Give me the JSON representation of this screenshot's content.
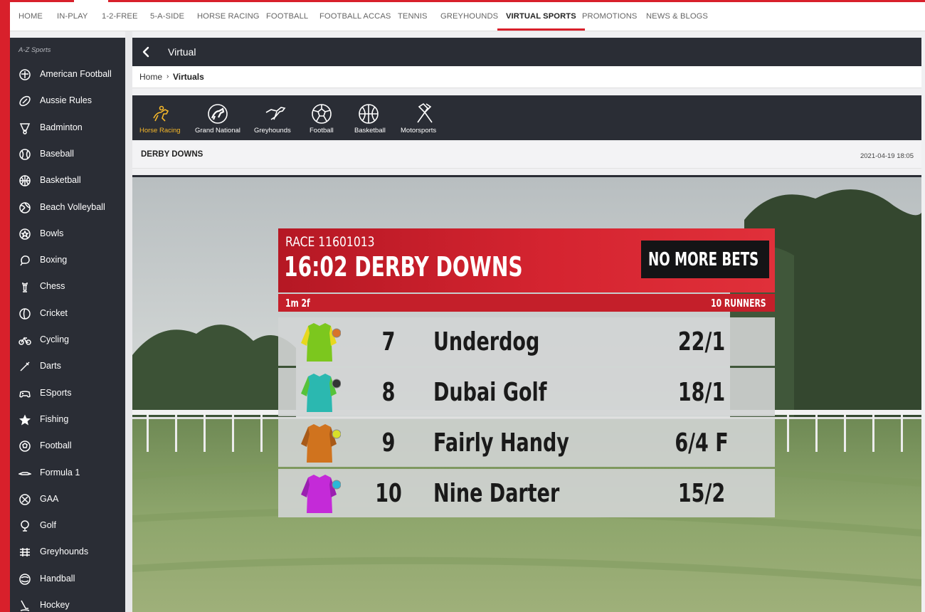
{
  "topnav": {
    "items": [
      "HOME",
      "IN-PLAY",
      "1-2-FREE",
      "5-A-SIDE",
      "HORSE RACING",
      "FOOTBALL",
      "FOOTBALL ACCAS",
      "TENNIS",
      "GREYHOUNDS",
      "VIRTUAL SPORTS",
      "PROMOTIONS",
      "NEWS & BLOGS"
    ],
    "active": "VIRTUAL SPORTS"
  },
  "sidebar": {
    "heading": "A-Z Sports",
    "items": [
      {
        "label": "American Football",
        "icon": "american-football-icon"
      },
      {
        "label": "Aussie Rules",
        "icon": "aussie-rules-icon"
      },
      {
        "label": "Badminton",
        "icon": "badminton-icon"
      },
      {
        "label": "Baseball",
        "icon": "baseball-icon"
      },
      {
        "label": "Basketball",
        "icon": "basketball-icon"
      },
      {
        "label": "Beach Volleyball",
        "icon": "volleyball-icon"
      },
      {
        "label": "Bowls",
        "icon": "bowls-icon"
      },
      {
        "label": "Boxing",
        "icon": "boxing-icon"
      },
      {
        "label": "Chess",
        "icon": "chess-icon"
      },
      {
        "label": "Cricket",
        "icon": "cricket-icon"
      },
      {
        "label": "Cycling",
        "icon": "cycling-icon"
      },
      {
        "label": "Darts",
        "icon": "darts-icon"
      },
      {
        "label": "ESports",
        "icon": "gamepad-icon"
      },
      {
        "label": "Fishing",
        "icon": "star-icon"
      },
      {
        "label": "Football",
        "icon": "football-icon"
      },
      {
        "label": "Formula 1",
        "icon": "formula1-icon"
      },
      {
        "label": "GAA",
        "icon": "gaa-icon"
      },
      {
        "label": "Golf",
        "icon": "golf-icon"
      },
      {
        "label": "Greyhounds",
        "icon": "greyhounds-icon"
      },
      {
        "label": "Handball",
        "icon": "handball-icon"
      },
      {
        "label": "Hockey",
        "icon": "hockey-icon"
      }
    ]
  },
  "header": {
    "title": "Virtual"
  },
  "breadcrumb": {
    "home": "Home",
    "separator": "›",
    "current": "Virtuals"
  },
  "virtual_tabs": {
    "items": [
      {
        "label": "Horse Racing",
        "icon": "horse-racing-icon"
      },
      {
        "label": "Grand National",
        "icon": "grand-national-icon"
      },
      {
        "label": "Greyhounds",
        "icon": "greyhound-icon"
      },
      {
        "label": "Football",
        "icon": "football-icon"
      },
      {
        "label": "Basketball",
        "icon": "basketball-icon"
      },
      {
        "label": "Motorsports",
        "icon": "chequered-flags-icon"
      }
    ],
    "active": "Horse Racing"
  },
  "event": {
    "name": "DERBY DOWNS",
    "datetime": "2021-04-19  18:05"
  },
  "stream": {
    "race_number": "RACE 11601013",
    "race_title": "16:02 DERBY DOWNS",
    "status": "NO MORE BETS",
    "distance": "1m 2f",
    "runners_count": "10 RUNNERS",
    "runners": [
      {
        "number": "7",
        "name": "Underdog",
        "odds": "22/1",
        "silk": "#7cc71e",
        "silk_accent": "#e8d81e",
        "cap": "#d8742a"
      },
      {
        "number": "8",
        "name": "Dubai Golf",
        "odds": "18/1",
        "silk": "#2bb8b0",
        "silk_accent": "#56c23a",
        "cap": "#333333"
      },
      {
        "number": "9",
        "name": "Fairly Handy",
        "odds": "6/4 F",
        "silk": "#d0731e",
        "silk_accent": "#a85a18",
        "cap": "#d8e02a"
      },
      {
        "number": "10",
        "name": "Nine Darter",
        "odds": "15/2",
        "silk": "#c42ad8",
        "silk_accent": "#9a20b0",
        "cap": "#2ab8d8"
      }
    ]
  },
  "colors": {
    "brand_red": "#d8202b",
    "dark_panel": "#2a2d35",
    "active_tab": "#f5b72a"
  }
}
